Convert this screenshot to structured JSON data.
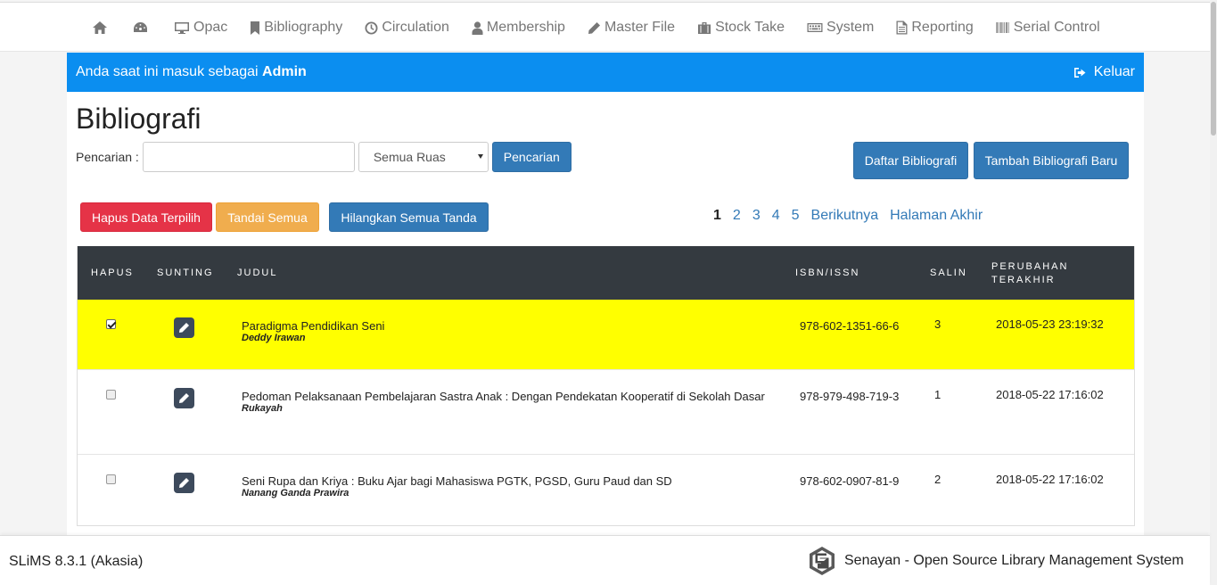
{
  "nav": {
    "items": [
      {
        "label": "",
        "icon": "home-icon"
      },
      {
        "label": "",
        "icon": "dashboard-icon"
      },
      {
        "label": "Opac",
        "icon": "desktop-icon"
      },
      {
        "label": "Bibliography",
        "icon": "bookmark-icon"
      },
      {
        "label": "Circulation",
        "icon": "clock-icon"
      },
      {
        "label": "Membership",
        "icon": "user-icon"
      },
      {
        "label": "Master File",
        "icon": "pencil-icon"
      },
      {
        "label": "Stock Take",
        "icon": "briefcase-icon"
      },
      {
        "label": "System",
        "icon": "keyboard-icon"
      },
      {
        "label": "Reporting",
        "icon": "file-icon"
      },
      {
        "label": "Serial Control",
        "icon": "barcode-icon"
      }
    ]
  },
  "info": {
    "prefix": "Anda saat ini masuk sebagai",
    "user": "Admin",
    "logout_label": "Keluar"
  },
  "page": {
    "title": "Bibliografi",
    "search_label": "Pencarian :",
    "search_value": "",
    "field_select": "Semua Ruas",
    "search_button": "Pencarian",
    "list_button": "Daftar Bibliografi",
    "add_button": "Tambah Bibliografi Baru",
    "delete_button": "Hapus Data Terpilih",
    "mark_all_button": "Tandai Semua",
    "unmark_all_button": "Hilangkan Semua Tanda"
  },
  "pagination": {
    "current": "1",
    "pages": [
      "2",
      "3",
      "4",
      "5"
    ],
    "next": "Berikutnya",
    "last": "Halaman Akhir"
  },
  "table": {
    "headers": {
      "delete": "HAPUS",
      "edit": "SUNTING",
      "title": "JUDUL",
      "isbn": "ISBN/ISSN",
      "copies": "SALIN",
      "modified_line1": "PERUBAHAN",
      "modified_line2": "TERAKHIR"
    },
    "rows": [
      {
        "checked": true,
        "title": "Paradigma Pendidikan Seni",
        "author": "Deddy Irawan",
        "isbn": "978-602-1351-66-6",
        "copies": "3",
        "modified": "2018-05-23 23:19:32"
      },
      {
        "checked": false,
        "title": "Pedoman Pelaksanaan Pembelajaran Sastra Anak : Dengan Pendekatan Kooperatif di Sekolah Dasar",
        "author": "Rukayah",
        "isbn": "978-979-498-719-3",
        "copies": "1",
        "modified": "2018-05-22 17:16:02"
      },
      {
        "checked": false,
        "title": "Seni Rupa dan Kriya : Buku Ajar bagi Mahasiswa PGTK, PGSD, Guru Paud dan SD",
        "author": "Nanang Ganda Prawira",
        "isbn": "978-602-0907-81-9",
        "copies": "2",
        "modified": "2018-05-22 17:16:02"
      }
    ]
  },
  "footer": {
    "version": "SLiMS 8.3.1 (Akasia)",
    "brand": "Senayan - Open Source Library Management System"
  },
  "colors": {
    "info_bar": "#0b8ef0",
    "primary": "#337ab7",
    "danger": "#e53347",
    "warning": "#f0ad4e",
    "table_header": "#343a40",
    "selected_row": "#ffff00"
  }
}
